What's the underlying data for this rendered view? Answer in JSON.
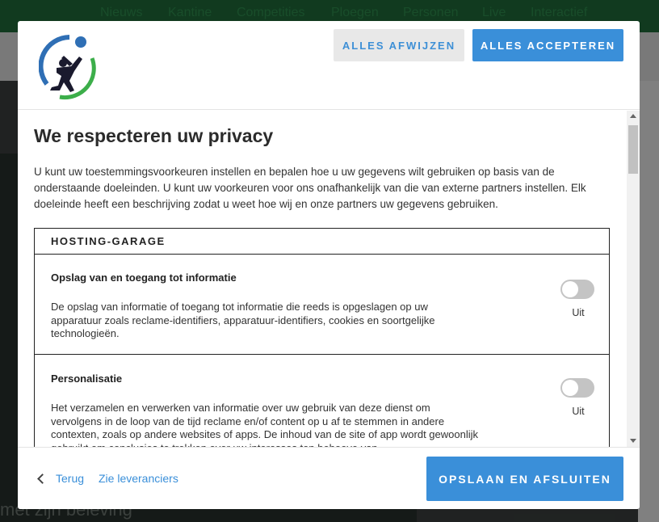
{
  "background": {
    "nav_items": [
      "Nieuws",
      "Kantine",
      "Competities",
      "Ploegen",
      "Personen",
      "Live",
      "Interactief"
    ],
    "footer_text": "met zijn beleving"
  },
  "header": {
    "logo_icon": "soccer-player-logo",
    "reject_label": "ALLES AFWIJZEN",
    "accept_label": "ALLES ACCEPTEREN"
  },
  "body": {
    "title": "We respecteren uw privacy",
    "intro": "U kunt uw toestemmingsvoorkeuren instellen en bepalen hoe u uw gegevens wilt gebruiken op basis van de onderstaande doeleinden. U kunt uw voorkeuren voor ons onafhankelijk van die van externe partners instellen. Elk doeleinde heeft een beschrijving zodat u weet hoe wij en onze partners uw gegevens gebruiken.",
    "vendor": {
      "name": "HOSTING-GARAGE",
      "purposes": [
        {
          "title": "Opslag van en toegang tot informatie",
          "description": "De opslag van informatie of toegang tot informatie die reeds is opgeslagen op uw apparatuur zoals reclame-identifiers, apparatuur-identifiers, cookies en soortgelijke technologieën.",
          "toggle_state": "Uit"
        },
        {
          "title": "Personalisatie",
          "description": "Het verzamelen en verwerken van informatie over uw gebruik van deze dienst om vervolgens in de loop van de tijd reclame en/of content op u af te stemmen in andere contexten, zoals op andere websites of apps. De inhoud van de site of app wordt gewoonlijk gebruikt om conclusies te trekken over uw interesses ten behoeve van",
          "toggle_state": "Uit"
        }
      ]
    }
  },
  "footer": {
    "back_label": "Terug",
    "vendors_label": "Zie leveranciers",
    "save_label": "OPSLAAN EN AFSLUITEN"
  },
  "colors": {
    "accent": "#3a8fd9",
    "toggle_off": "#c4c4c4"
  }
}
